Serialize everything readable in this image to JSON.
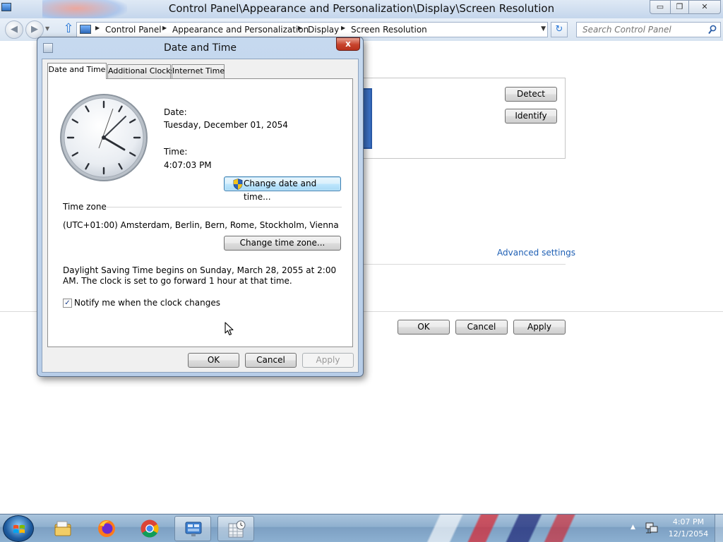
{
  "window": {
    "title": "Control Panel\\Appearance and Personalization\\Display\\Screen Resolution",
    "min_label": "▭",
    "max_label": "❐",
    "close_label": "✕"
  },
  "nav": {
    "back_label": "◀",
    "forward_label": "▶",
    "history_label": "▼",
    "up_label": "⇧",
    "breadcrumbs": [
      "Control Panel",
      "Appearance and Personalization",
      "Display",
      "Screen Resolution"
    ],
    "dropdown_label": "▼",
    "refresh_label": "↻",
    "search_placeholder": "Search Control Panel"
  },
  "screen_resolution": {
    "detect_label": "Detect",
    "identify_label": "Identify",
    "advanced_settings_label": "Advanced settings",
    "ok_label": "OK",
    "cancel_label": "Cancel",
    "apply_label": "Apply"
  },
  "dialog": {
    "title": "Date and Time",
    "close_label": "x",
    "tabs": [
      {
        "label": "Date and Time"
      },
      {
        "label": "Additional Clocks"
      },
      {
        "label": "Internet Time"
      }
    ],
    "date_label": "Date:",
    "date_value": "Tuesday, December 01, 2054",
    "time_label": "Time:",
    "time_value": "4:07:03 PM",
    "change_date_time_label": "Change date and time...",
    "time_zone_header": "Time zone",
    "time_zone_value": "(UTC+01:00) Amsterdam, Berlin, Bern, Rome, Stockholm, Vienna",
    "change_time_zone_label": "Change time zone...",
    "dst_text": "Daylight Saving Time begins on Sunday, March 28, 2055 at 2:00 AM. The clock is set to go forward 1 hour at that time.",
    "notify_checked": true,
    "notify_check_glyph": "✓",
    "notify_label": "Notify me when the clock changes",
    "ok_label": "OK",
    "cancel_label": "Cancel",
    "apply_label": "Apply"
  },
  "taskbar": {
    "items": [
      {
        "icon": "windows-explorer-icon",
        "active": false
      },
      {
        "icon": "firefox-icon",
        "active": false
      },
      {
        "icon": "chrome-icon",
        "active": false
      },
      {
        "icon": "control-panel-icon",
        "active": true
      },
      {
        "icon": "date-time-icon",
        "active": true
      }
    ],
    "tray_arrow": "▲",
    "clock_time": "4:07 PM",
    "clock_date": "12/1/2054"
  },
  "colors": {
    "link": "#1e5fb4",
    "dialog_frame": "#c6d9ef",
    "taskbar": "#8fb0cf",
    "close_button": "#c7422b"
  }
}
